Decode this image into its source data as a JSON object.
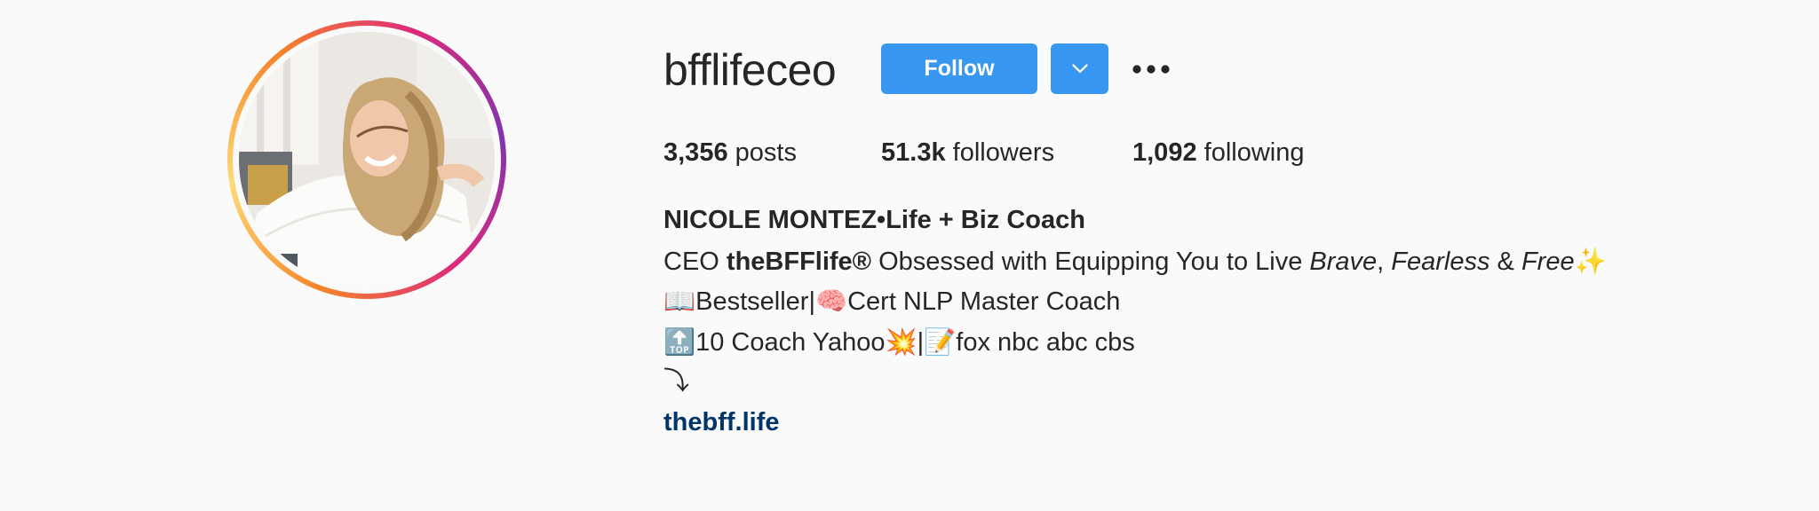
{
  "profile": {
    "username": "bfflifeceo",
    "follow_label": "Follow",
    "dropdown_icon": "chevron-down-icon",
    "more_icon": "more-options-icon",
    "accent_color": "#3897f0"
  },
  "stats": {
    "posts_count": "3,356",
    "posts_label": "posts",
    "followers_count": "51.3k",
    "followers_label": "followers",
    "following_count": "1,092",
    "following_label": "following"
  },
  "bio": {
    "name": "NICOLE MONTEZ•Life + Biz Coach",
    "line1": {
      "prefix": "CEO ",
      "brand": "theBFFlife®",
      "middle": " Obsessed with Equipping You to Live ",
      "brave": "Brave",
      "comma": ", ",
      "fearless": "Fearless",
      "amp": " & ",
      "free": "Free",
      "sparkles": "✨"
    },
    "line2": {
      "book": "📖",
      "bestseller": "Bestseller|",
      "brain": "🧠",
      "cert": "Cert NLP Master Coach"
    },
    "line3": {
      "top": "🔝",
      "coach": "10 Coach Yahoo",
      "collision": "💥",
      "pipe": "|",
      "memo": "📝",
      "outlets": "fox nbc abc cbs"
    },
    "arrow": "⤵",
    "link": "thebff.life",
    "link_color": "#003569"
  }
}
